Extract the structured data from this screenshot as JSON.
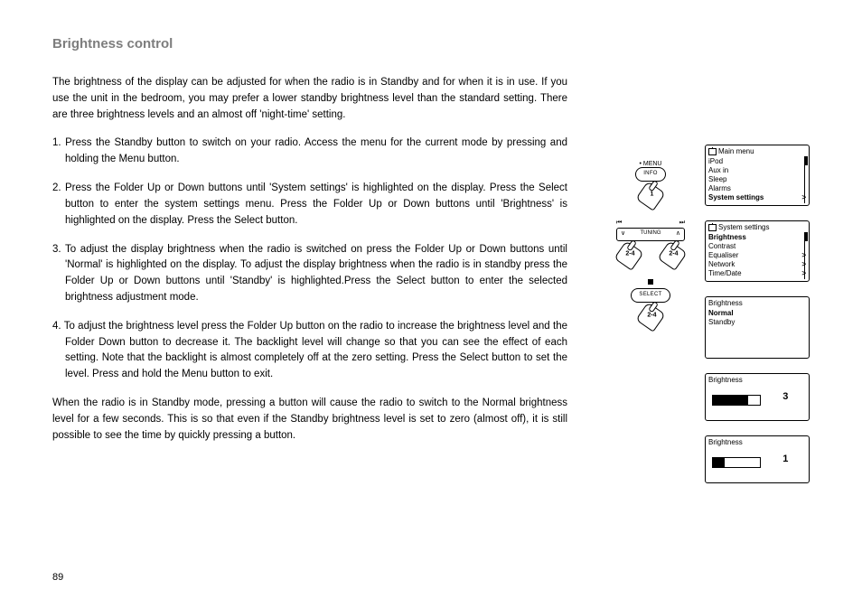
{
  "title": "Brightness control",
  "intro": "The brightness of the display can be adjusted for when the radio is in Standby and for when it is in use. If you use the unit in the bedroom, you may prefer a lower standby brightness level than the standard setting. There are three brightness levels and an almost off 'night-time' setting.",
  "steps": {
    "s1": "1. Press the Standby button to switch on your radio. Access the menu for the current mode by pressing and holding the Menu button.",
    "s2": "2. Press the Folder Up or Down buttons until 'System settings' is highlighted on the display. Press the Select button to enter the system settings menu. Press the Folder Up or Down buttons until 'Brightness' is highlighted on the display. Press the Select button.",
    "s3": "3. To adjust the display brightness when the radio is switched on press the Folder Up or Down buttons until 'Normal' is highlighted on the display. To adjust the display brightness when the radio is in standby press the Folder Up or Down buttons until 'Standby' is highlighted.Press the Select button to enter the selected brightness adjustment mode.",
    "s4": "4. To adjust the brightness level press the Folder Up button on the radio to increase the brightness level and the Folder Down button to decrease it. The backlight level will change so that you can see the effect of each setting. Note that the backlight is almost completely off at the zero setting. Press the Select button to set the level. Press and hold the Menu button to exit."
  },
  "outro": "When the radio is in Standby mode, pressing a button will cause the radio to switch to the Normal brightness level for a few seconds. This is so that even if the Standby brightness level is set to zero (almost off), it is still possible to see the time by quickly pressing a button.",
  "pageNumber": "89",
  "buttons": {
    "menuDot": "• MENU",
    "info": "INFO",
    "tuning": "TUNING",
    "select": "SELECT",
    "hand1": "1",
    "hand24": "2-4"
  },
  "lcd1": {
    "header": "Main menu",
    "r1": "iPod",
    "r2": "Aux in",
    "r3": "Sleep",
    "r4": "Alarms",
    "r5": "System settings",
    "chev": ">"
  },
  "lcd2": {
    "header": "System settings",
    "r1": "Brightness",
    "r2": "Contrast",
    "r3": "Equaliser",
    "r4": "Network",
    "r5": "Time/Date",
    "chev": ">"
  },
  "lcd3": {
    "header": "Brightness",
    "r1": "Normal",
    "r2": "Standby"
  },
  "lcd4": {
    "header": "Brightness",
    "value": "3",
    "fillPct": 75
  },
  "lcd5": {
    "header": "Brightness",
    "value": "1",
    "fillPct": 25
  }
}
